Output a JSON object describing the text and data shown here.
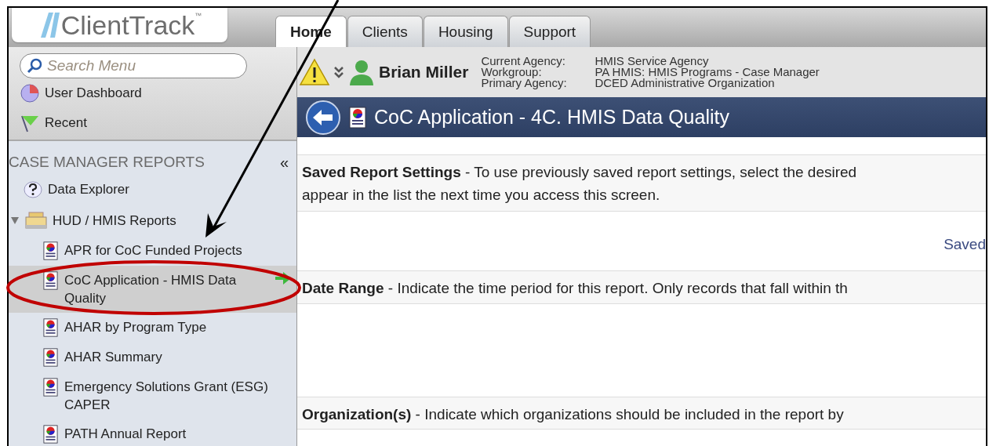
{
  "logo": {
    "text": "ClientTrack",
    "mark": "™"
  },
  "tabs": [
    {
      "label": "Home",
      "selected": true
    },
    {
      "label": "Clients",
      "selected": false
    },
    {
      "label": "Housing",
      "selected": false
    },
    {
      "label": "Support",
      "selected": false
    }
  ],
  "search": {
    "placeholder": "Search Menu"
  },
  "quick_links": [
    {
      "label": "User Dashboard",
      "kind": "dashboard"
    },
    {
      "label": "Recent",
      "kind": "recent"
    }
  ],
  "sidebar": {
    "title": "CASE MANAGER REPORTS",
    "collapse": "«",
    "items": [
      {
        "label": "Data Explorer",
        "kind": "help"
      },
      {
        "label": "HUD / HMIS Reports",
        "kind": "folder",
        "expanded": true,
        "children": [
          {
            "label": "APR for CoC Funded Projects",
            "selected": false
          },
          {
            "label": "CoC Application - HMIS Data Quality",
            "selected": true
          },
          {
            "label": "AHAR by Program Type",
            "selected": false
          },
          {
            "label": "AHAR Summary",
            "selected": false
          },
          {
            "label": "Emergency Solutions Grant (ESG) CAPER",
            "selected": false
          },
          {
            "label": "PATH Annual Report",
            "selected": false
          }
        ]
      }
    ]
  },
  "user": {
    "name": "Brian Miller",
    "details": [
      {
        "label": "Current Agency:",
        "value": "HMIS Service Agency"
      },
      {
        "label": "Workgroup:",
        "value": "PA HMIS: HMIS Programs - Case Manager"
      },
      {
        "label": "Primary Agency:",
        "value": "DCED Administrative Organization"
      }
    ]
  },
  "page_title": "CoC Application - 4C. HMIS Data Quality",
  "sections": [
    {
      "lines": [
        "**Saved Report Settings** - To use previously saved report settings, select the desired",
        "appear in the list the next time you access this screen."
      ],
      "body": "Saved"
    },
    {
      "lines": [
        "**Date Range** - Indicate the time period for this report. Only records that fall within th"
      ]
    },
    {
      "lines": [
        "**Organization(s)** - Indicate which organizations should be included in the report by"
      ]
    }
  ]
}
